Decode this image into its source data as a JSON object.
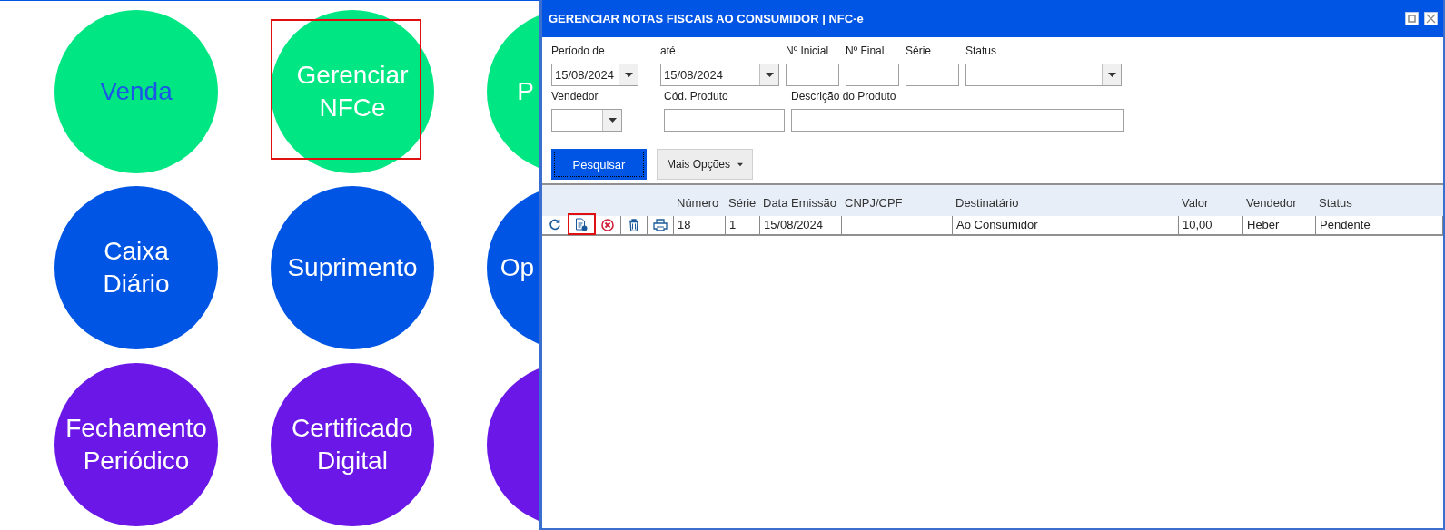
{
  "tiles": [
    {
      "lines": [
        "Venda"
      ],
      "color": "#00e682",
      "kind": "accent",
      "highlighted": false
    },
    {
      "lines": [
        "Gerenciar",
        "NFCe"
      ],
      "color": "#00e682",
      "kind": "plain",
      "highlighted": true
    },
    {
      "lines": [
        "P"
      ],
      "color": "#00e682",
      "kind": "plain",
      "highlighted": false
    },
    {
      "lines": [
        "Caixa",
        "Diário"
      ],
      "color": "#0055e5",
      "kind": "plain",
      "highlighted": false
    },
    {
      "lines": [
        "Suprimento"
      ],
      "color": "#0055e5",
      "kind": "plain",
      "highlighted": false
    },
    {
      "lines": [
        "Op"
      ],
      "color": "#0055e5",
      "kind": "plain",
      "highlighted": false
    },
    {
      "lines": [
        "Fechamento",
        "Periódico"
      ],
      "color": "#6a17e8",
      "kind": "plain",
      "highlighted": false
    },
    {
      "lines": [
        "Certificado",
        "Digital"
      ],
      "color": "#6a17e8",
      "kind": "plain",
      "highlighted": false
    },
    {
      "color": "#6a17e8",
      "kind": "plain",
      "highlighted": false
    }
  ],
  "window": {
    "title": "GERENCIAR NOTAS FISCAIS AO CONSUMIDOR | NFC-e",
    "filters": {
      "period_from": {
        "label": "Período de",
        "value": "15/08/2024"
      },
      "period_to": {
        "label": "até",
        "value": "15/08/2024"
      },
      "number_start": {
        "label": "Nº Inicial"
      },
      "number_end": {
        "label": "Nº Final"
      },
      "series": {
        "label": "Série"
      },
      "status": {
        "label": "Status"
      },
      "seller": {
        "label": "Vendedor"
      },
      "product_code": {
        "label": "Cód. Produto"
      },
      "product_description": {
        "label": "Descrição do Produto"
      }
    },
    "buttons": {
      "search": "Pesquisar",
      "more_options": "Mais Opções"
    },
    "table": {
      "columns": [
        "Número",
        "Série",
        "Data Emissão",
        "CNPJ/CPF",
        "Destinatário",
        "Valor",
        "Vendedor",
        "Status"
      ],
      "rows": [
        {
          "actions": [
            {
              "kind": "refresh",
              "highlighted": false
            },
            {
              "kind": "document",
              "highlighted": true
            },
            {
              "kind": "cancel",
              "highlighted": false
            },
            {
              "kind": "delete",
              "highlighted": false
            },
            {
              "kind": "print",
              "highlighted": false
            }
          ],
          "cells": [
            "18",
            "1",
            "15/08/2024",
            "",
            "Ao Consumidor",
            "10,00",
            "Heber",
            "Pendente"
          ]
        }
      ]
    }
  }
}
